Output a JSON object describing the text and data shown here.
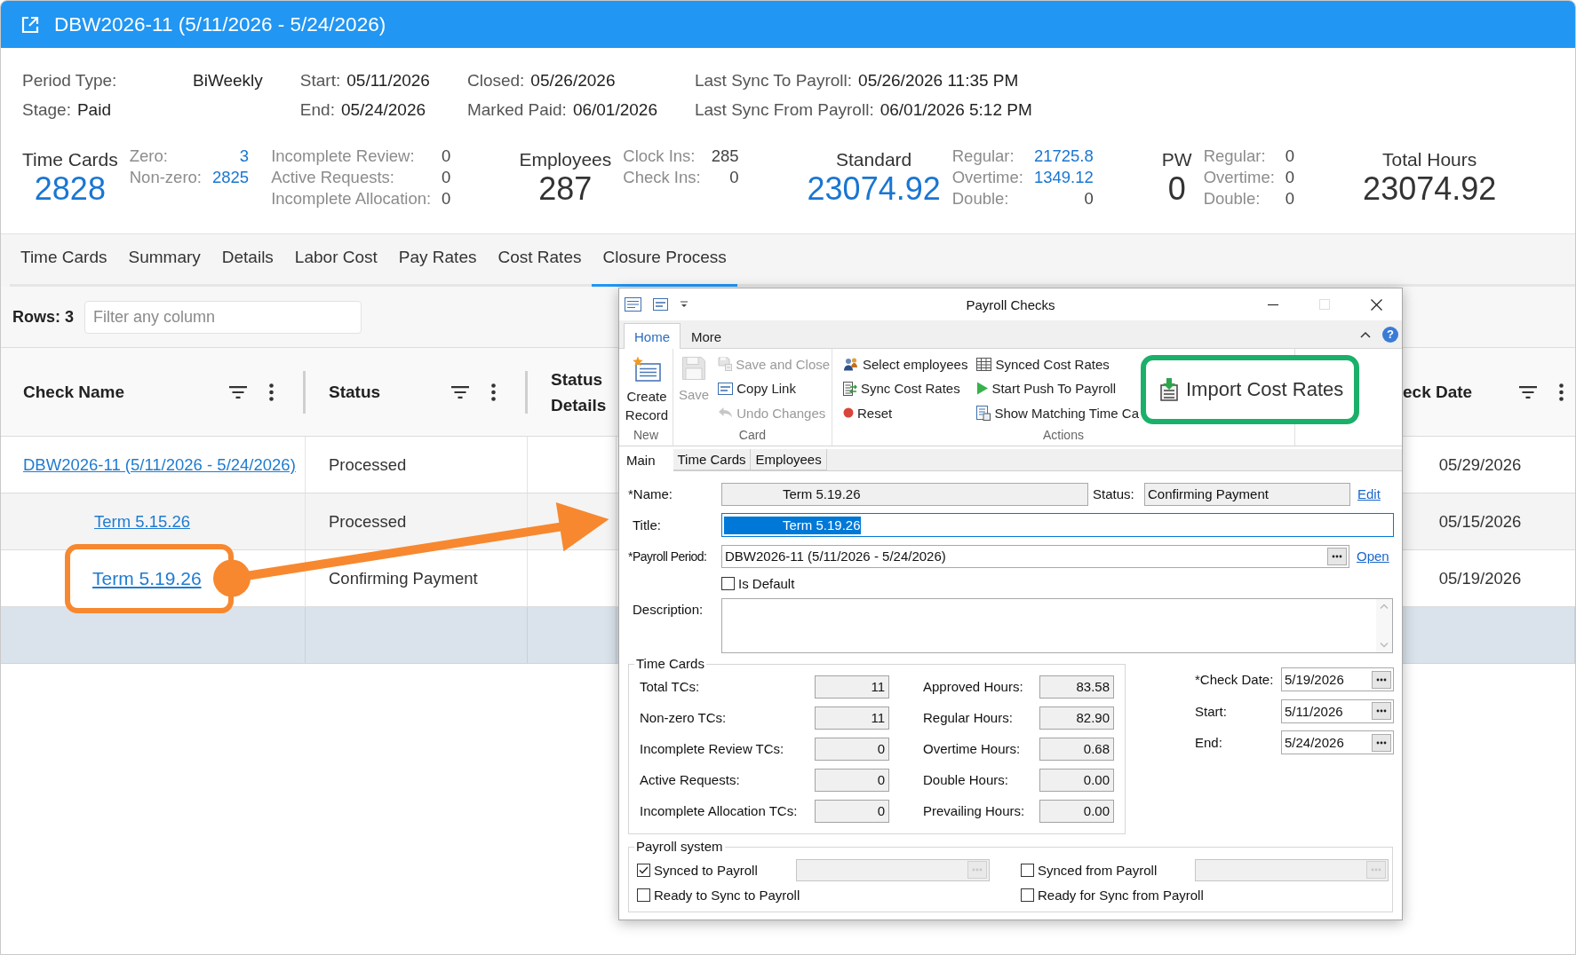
{
  "header": {
    "title": "DBW2026-11 (5/11/2026 - 5/24/2026)"
  },
  "info": [
    [
      {
        "label": "Period Type:",
        "value": "BiWeekly"
      },
      {
        "label": "Stage:",
        "value": "Paid"
      }
    ],
    [
      {
        "label": "Start:",
        "value": "05/11/2026"
      },
      {
        "label": "End:",
        "value": "05/24/2026"
      }
    ],
    [
      {
        "label": "Closed:",
        "value": "05/26/2026"
      },
      {
        "label": "Marked Paid:",
        "value": "06/01/2026"
      }
    ],
    [
      {
        "label": "Last Sync To Payroll:",
        "value": "05/26/2026 11:35 PM"
      },
      {
        "label": "Last Sync From Payroll:",
        "value": "06/01/2026 5:12 PM"
      }
    ]
  ],
  "stats": [
    {
      "title": "Time Cards",
      "value": "2828",
      "linked": true,
      "details": [
        [
          {
            "label": "Zero:",
            "value": "3",
            "linked": true
          },
          {
            "label": "Non-zero:",
            "value": "2825",
            "linked": true
          }
        ],
        [
          {
            "label": "Incomplete Review:",
            "value": "0",
            "linked": false
          },
          {
            "label": "Active Requests:",
            "value": "0",
            "linked": false
          },
          {
            "label": "Incomplete Allocation:",
            "value": "0",
            "linked": false
          }
        ]
      ]
    },
    {
      "title": "Employees",
      "value": "287",
      "linked": false,
      "details": [
        [
          {
            "label": "Clock Ins:",
            "value": "285",
            "linked": false
          },
          {
            "label": "Check Ins:",
            "value": "0",
            "linked": false
          }
        ]
      ]
    },
    {
      "title": "Standard",
      "value": "23074.92",
      "linked": true,
      "details": [
        [
          {
            "label": "Regular:",
            "value": "21725.8",
            "linked": true
          },
          {
            "label": "Overtime:",
            "value": "1349.12",
            "linked": true
          },
          {
            "label": "Double:",
            "value": "0",
            "linked": false
          }
        ]
      ]
    },
    {
      "title": "PW",
      "value": "0",
      "linked": false,
      "details": [
        [
          {
            "label": "Regular:",
            "value": "0",
            "linked": false
          },
          {
            "label": "Overtime:",
            "value": "0",
            "linked": false
          },
          {
            "label": "Double:",
            "value": "0",
            "linked": false
          }
        ]
      ]
    },
    {
      "title": "Total Hours",
      "value": "23074.92",
      "linked": false
    }
  ],
  "tabs": [
    {
      "label": "Time Cards",
      "selected": false
    },
    {
      "label": "Summary",
      "selected": false
    },
    {
      "label": "Details",
      "selected": false
    },
    {
      "label": "Labor Cost",
      "selected": false
    },
    {
      "label": "Pay Rates",
      "selected": false
    },
    {
      "label": "Cost Rates",
      "selected": false
    },
    {
      "label": "Closure Process",
      "selected": true
    }
  ],
  "toolbar": {
    "rows_label": "Rows: 3",
    "filter": {
      "placeholder": "Filter any column"
    }
  },
  "table": {
    "columns": [
      {
        "label": "Check Name",
        "filter": true
      },
      {
        "label": "Status",
        "filter": true
      },
      {
        "label": "Status Details",
        "filter": false
      },
      {
        "label": "eck Date",
        "filter": true
      }
    ],
    "rows": [
      {
        "check_name": "DBW2026-11 (5/11/2026 - 5/24/2026)",
        "status": "Processed",
        "column_4": "05/29/2026",
        "highlighted": false,
        "children": [
          {
            "check_name": "Term 5.15.26",
            "status": "Processed",
            "column_4": "05/15/2026",
            "highlighted": false
          },
          {
            "check_name": "Term 5.19.26",
            "status": "Confirming Payment",
            "column_4": "05/19/2026",
            "highlighted": true
          }
        ]
      }
    ]
  },
  "dialog": {
    "title": "Payroll Checks",
    "window_buttons": [
      {
        "kind": "minimize",
        "disabled": false
      },
      {
        "kind": "maximize",
        "disabled": true
      },
      {
        "kind": "close",
        "disabled": false
      }
    ],
    "ribbon": {
      "tabs": [
        {
          "label": "Home",
          "selected": true
        },
        {
          "label": "More",
          "selected": false
        }
      ],
      "help": "?",
      "groups": [
        {
          "label": "New",
          "items": [
            {
              "kind": "large",
              "label": "Create Record",
              "disabled": false,
              "highlighted": false
            }
          ]
        },
        {
          "label": "Card",
          "items": [
            {
              "kind": "large",
              "label": "Save",
              "disabled": true,
              "highlighted": false
            },
            {
              "kind": "small",
              "label": "Save and Close",
              "disabled": true,
              "highlighted": false
            },
            {
              "kind": "small",
              "label": "Copy Link",
              "disabled": false,
              "highlighted": false
            },
            {
              "kind": "small",
              "label": "Undo Changes",
              "disabled": true,
              "highlighted": false
            }
          ]
        },
        {
          "label": "Actions",
          "items": [
            {
              "kind": "small",
              "label": "Select employees",
              "disabled": false,
              "highlighted": false
            },
            {
              "kind": "small",
              "label": "Sync Cost Rates",
              "disabled": false,
              "highlighted": false
            },
            {
              "kind": "small",
              "label": "Reset",
              "disabled": false,
              "highlighted": false
            },
            {
              "kind": "small",
              "label": "Synced Cost Rates",
              "disabled": false,
              "highlighted": false
            },
            {
              "kind": "small",
              "label": "Start Push To Payroll",
              "disabled": false,
              "highlighted": false
            },
            {
              "kind": "small",
              "label": "Show Matching Time Ca",
              "disabled": false,
              "highlighted": false
            },
            {
              "kind": "featured",
              "label": "Import Cost Rates",
              "disabled": false,
              "highlighted": true
            }
          ]
        }
      ]
    },
    "tabs": [
      {
        "label": "Main",
        "selected": true
      },
      {
        "label": "Time Cards",
        "selected": false
      },
      {
        "label": "Employees",
        "selected": false
      }
    ],
    "form": {
      "name": {
        "label": "*Name:",
        "value": "Term 5.19.26"
      },
      "status": {
        "label": "Status:",
        "value": "Confirming Payment",
        "link": "Edit"
      },
      "title": {
        "label": "Title:",
        "value": "Term 5.19.26",
        "text_selected": true
      },
      "payroll_period": {
        "label": "*Payroll Period:",
        "value": "DBW2026-11 (5/11/2026 - 5/24/2026)",
        "link": "Open"
      },
      "is_default": {
        "label": "Is Default",
        "checked": false
      },
      "description": {
        "label": "Description:"
      }
    },
    "time_cards": {
      "title": "Time Cards",
      "columns": [
        [
          {
            "label": "Total TCs:",
            "value": "11"
          },
          {
            "label": "Non-zero TCs:",
            "value": "11"
          },
          {
            "label": "Incomplete Review TCs:",
            "value": "0"
          },
          {
            "label": "Active Requests:",
            "value": "0"
          },
          {
            "label": "Incomplete Allocation TCs:",
            "value": "0"
          }
        ],
        [
          {
            "label": "Approved Hours:",
            "value": "83.58"
          },
          {
            "label": "Regular Hours:",
            "value": "82.90"
          },
          {
            "label": "Overtime Hours:",
            "value": "0.68"
          },
          {
            "label": "Double Hours:",
            "value": "0.00"
          },
          {
            "label": "Prevailing Hours:",
            "value": "0.00"
          }
        ]
      ]
    },
    "dates": [
      {
        "label": "*Check Date:",
        "value": "5/19/2026"
      },
      {
        "label": "Start:",
        "value": "5/11/2026"
      },
      {
        "label": "End:",
        "value": "5/24/2026"
      }
    ],
    "payroll_system": {
      "title": "Payroll system",
      "options": [
        {
          "kind": "with_field",
          "label": "Synced to Payroll",
          "checked": true
        },
        {
          "kind": "with_field",
          "label": "Synced from Payroll",
          "checked": false
        },
        {
          "kind": "plain",
          "label": "Ready to Sync to Payroll",
          "checked": false
        },
        {
          "kind": "plain",
          "label": "Ready for Sync from Payroll",
          "checked": false
        }
      ]
    }
  }
}
